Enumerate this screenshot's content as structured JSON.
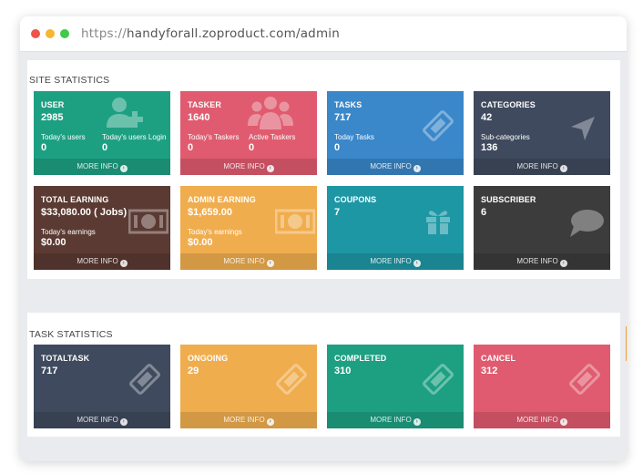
{
  "browser": {
    "url_protocol": "https://",
    "url_host": "handyforall.zoproduct.com/admin"
  },
  "site_statistics": {
    "title": "SITE STATISTICS",
    "more_info": "MORE INFO",
    "user": {
      "title": "USER",
      "value": "2985",
      "sub1_label": "Today's users",
      "sub1_value": "0",
      "sub2_label": "Today's users Login",
      "sub2_value": "0",
      "color": "#1da082"
    },
    "tasker": {
      "title": "TASKER",
      "value": "1640",
      "sub1_label": "Today's Taskers",
      "sub1_value": "0",
      "sub2_label": "Active Taskers",
      "sub2_value": "0",
      "color": "#e05b6f"
    },
    "tasks": {
      "title": "TASKS",
      "value": "717",
      "sub1_label": "Today Tasks",
      "sub1_value": "0",
      "color": "#3a87c9"
    },
    "categories": {
      "title": "CATEGORIES",
      "value": "42",
      "sub1_label": "Sub-categories",
      "sub1_value": "136",
      "color": "#3f4a5e"
    },
    "total_earning": {
      "title": "TOTAL EARNING",
      "value": "$33,080.00 ( Jobs)",
      "sub1_label": "Today's earnings",
      "sub1_value": "$0.00",
      "color": "#5a3a32"
    },
    "admin_earning": {
      "title": "ADMIN EARNING",
      "value": "$1,659.00",
      "sub1_label": "Today's earnings",
      "sub1_value": "$0.00",
      "color": "#f0ad4e"
    },
    "coupons": {
      "title": "COUPONS",
      "value": "7",
      "color": "#1e97a5"
    },
    "subscriber": {
      "title": "SUBSCRIBER",
      "value": "6",
      "color": "#3c3c3c"
    }
  },
  "task_statistics": {
    "title": "TASK STATISTICS",
    "more_info": "MORE INFO",
    "totaltask": {
      "title": "TOTALTASK",
      "value": "717",
      "color": "#3f4a5e"
    },
    "ongoing": {
      "title": "ONGOING",
      "value": "29",
      "color": "#f0ad4e"
    },
    "completed": {
      "title": "COMPLETED",
      "value": "310",
      "color": "#1da082"
    },
    "cancel": {
      "title": "CANCEL",
      "value": "312",
      "color": "#e05b6f"
    }
  }
}
